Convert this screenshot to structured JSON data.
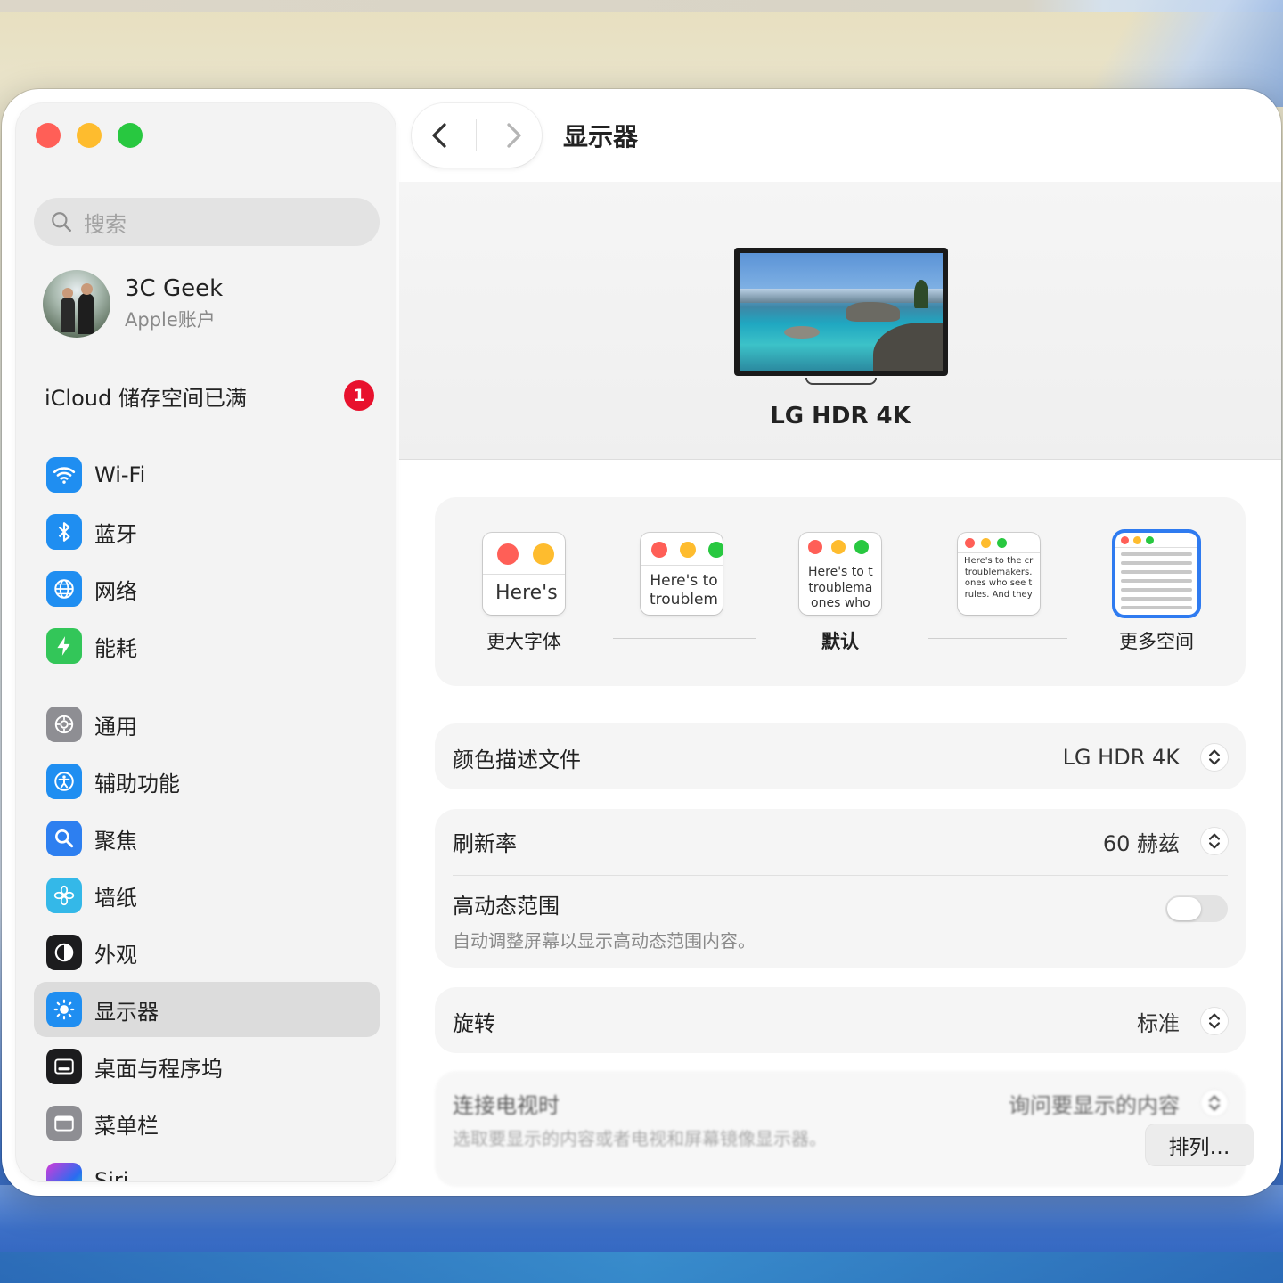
{
  "window": {
    "title": "显示器"
  },
  "sidebar": {
    "search_placeholder": "搜索",
    "account": {
      "name": "3C Geek",
      "subtitle": "Apple账户"
    },
    "icloud": {
      "label": "iCloud 储存空间已满",
      "badge": "1"
    },
    "items": [
      {
        "label": "Wi-Fi",
        "icon": "wifi-icon"
      },
      {
        "label": "蓝牙",
        "icon": "bluetooth-icon"
      },
      {
        "label": "网络",
        "icon": "globe-icon"
      },
      {
        "label": "能耗",
        "icon": "bolt-icon"
      },
      {
        "label": "通用",
        "icon": "gear-icon"
      },
      {
        "label": "辅助功能",
        "icon": "accessibility-icon"
      },
      {
        "label": "聚焦",
        "icon": "magnifier-icon"
      },
      {
        "label": "墙纸",
        "icon": "flower-icon"
      },
      {
        "label": "外观",
        "icon": "appearance-icon"
      },
      {
        "label": "显示器",
        "icon": "brightness-icon",
        "selected": true
      },
      {
        "label": "桌面与程序坞",
        "icon": "dock-icon"
      },
      {
        "label": "菜单栏",
        "icon": "menubar-icon"
      },
      {
        "label": "Siri",
        "icon": "siri-icon"
      }
    ]
  },
  "display": {
    "name": "LG HDR 4K",
    "scaling": {
      "options": [
        {
          "label": "更大字体",
          "preview_text": "Here's"
        },
        {
          "label": "",
          "preview_text_1": "Here's to",
          "preview_text_2": "troublem"
        },
        {
          "label": "默认",
          "preview_text_1": "Here's to t",
          "preview_text_2": "troublema",
          "preview_text_3": "ones who"
        },
        {
          "label": "",
          "preview_lines": [
            "Here's to the cr",
            "troublemakers.",
            "ones who see t",
            "rules. And they"
          ]
        },
        {
          "label": "更多空间",
          "selected": true
        }
      ]
    },
    "color_profile": {
      "label": "颜色描述文件",
      "value": "LG HDR 4K"
    },
    "refresh_rate": {
      "label": "刷新率",
      "value": "60 赫兹"
    },
    "hdr": {
      "label": "高动态范围",
      "description": "自动调整屏幕以显示高动态范围内容。",
      "enabled": false
    },
    "rotation": {
      "label": "旋转",
      "value": "标准"
    },
    "tv": {
      "label": "连接电视时",
      "value": "询问要显示的内容",
      "description": "选取要显示的内容或者电视和屏幕镜像显示器。"
    }
  },
  "arrange_button": "排列…",
  "colors": {
    "accent": "#2f7bf0",
    "badge": "#e8112d",
    "close": "#ff5f57",
    "minimize": "#febc2e",
    "maximize": "#28c840"
  }
}
